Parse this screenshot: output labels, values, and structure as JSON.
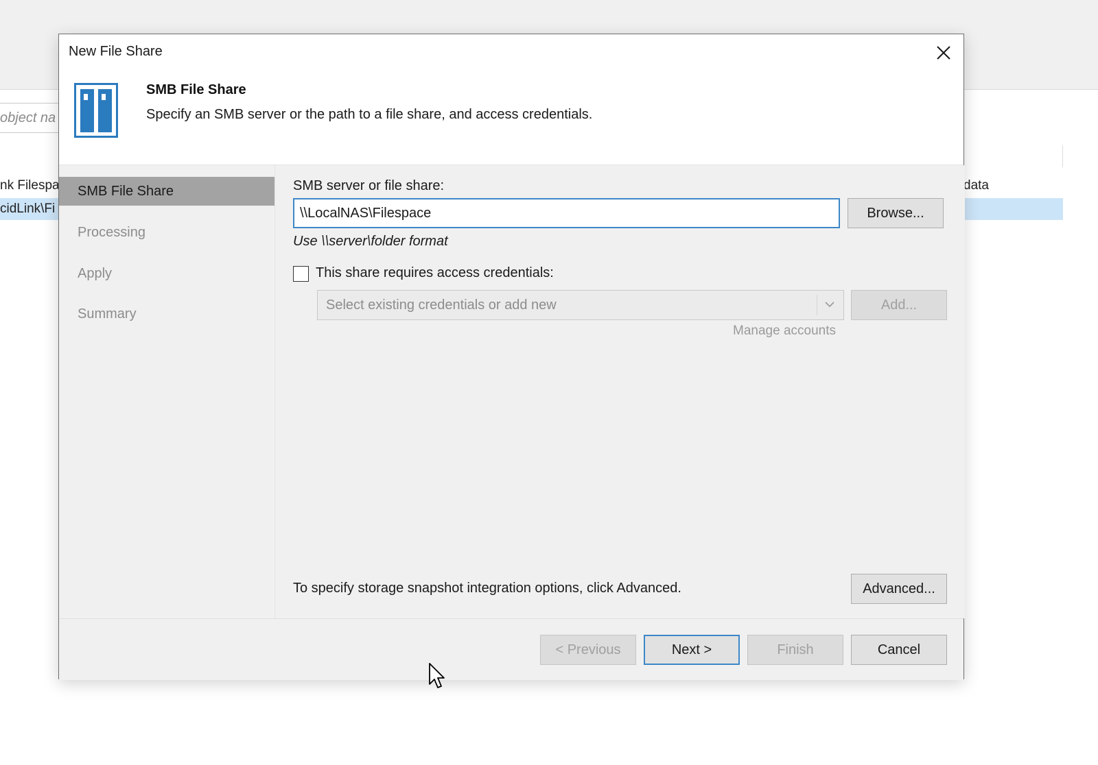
{
  "background": {
    "search_placeholder": "object na",
    "row1_text": "nk Filespa",
    "row2_text": "cidLink\\Fi",
    "right_col_header": "data"
  },
  "dialog": {
    "title": "New File Share",
    "close_icon": "close-icon",
    "header": {
      "icon": "file-share-icon",
      "title": "SMB File Share",
      "description": "Specify an SMB server or the path to a file share, and access credentials."
    },
    "steps": [
      {
        "label": "SMB File Share",
        "active": true
      },
      {
        "label": "Processing",
        "active": false
      },
      {
        "label": "Apply",
        "active": false
      },
      {
        "label": "Summary",
        "active": false
      }
    ],
    "form": {
      "share_label": "SMB server or file share:",
      "share_value": "\\\\LocalNAS\\Filespace",
      "browse_label": "Browse...",
      "format_hint": "Use \\\\server\\folder format",
      "credentials_checkbox_label": "This share requires access credentials:",
      "credentials_checked": false,
      "credentials_placeholder": "Select existing credentials or add new",
      "add_label": "Add...",
      "manage_accounts_label": "Manage accounts",
      "advanced_text": "To specify storage snapshot integration options, click Advanced.",
      "advanced_label": "Advanced..."
    },
    "footer": {
      "previous_label": "< Previous",
      "next_label": "Next >",
      "finish_label": "Finish",
      "cancel_label": "Cancel"
    }
  },
  "colors": {
    "accent": "#3d87c7",
    "selected_step": "#a3a3a3",
    "icon_blue": "#2b7bbf",
    "selection_row": "#cce4f7"
  }
}
